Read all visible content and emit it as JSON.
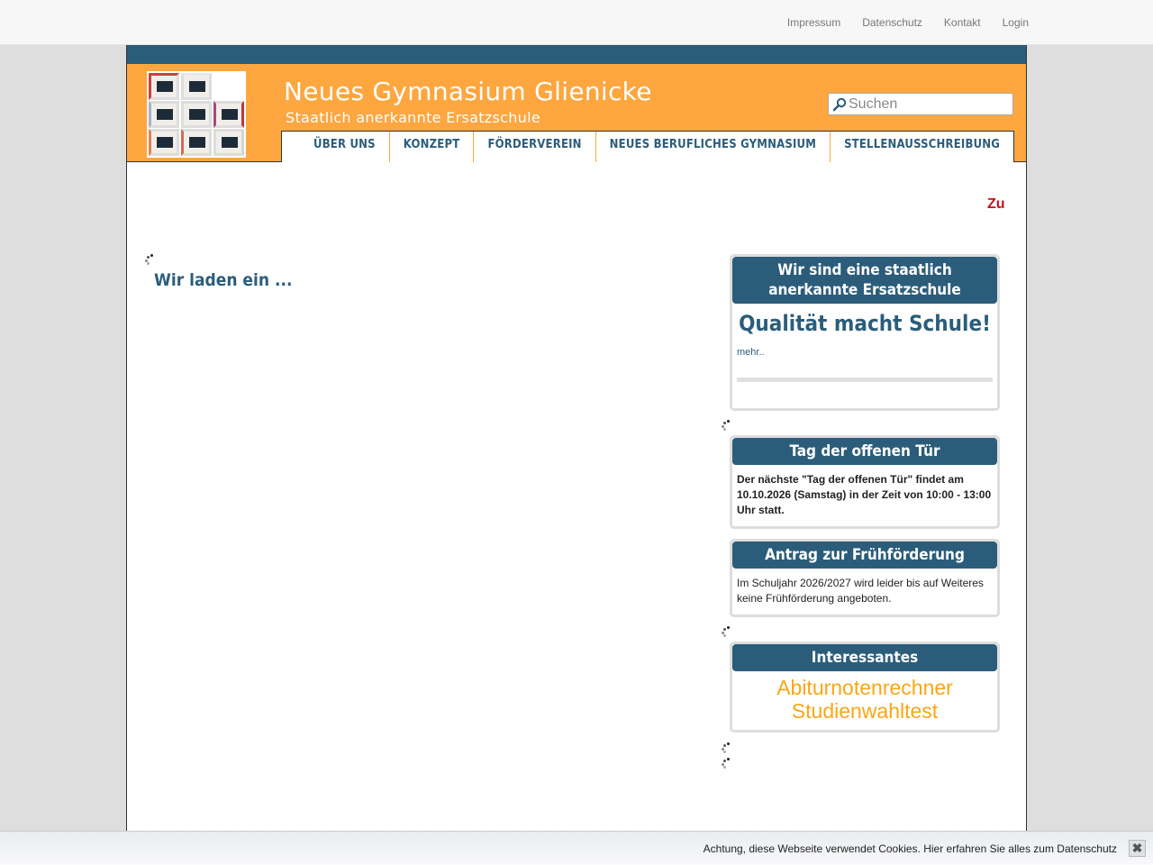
{
  "topnav": {
    "impressum": "Impressum",
    "datenschutz": "Datenschutz",
    "kontakt": "Kontakt",
    "login": "Login"
  },
  "header": {
    "title": "Neues Gymnasium Glienicke",
    "subtitle": "Staatlich anerkannte Ersatzschule",
    "brand_color": "#fea63f",
    "accent_color": "#2b5d7b"
  },
  "search": {
    "placeholder": "Suchen",
    "icon": "search-icon"
  },
  "mainnav": [
    {
      "label": "Über uns"
    },
    {
      "label": "Konzept"
    },
    {
      "label": "Förderverein"
    },
    {
      "label": "Neues berufliches Gymnasium"
    },
    {
      "label": "Stellenausschreibung"
    }
  ],
  "ticker": {
    "text": "Zu"
  },
  "main": {
    "lead": "Wir laden ein ..."
  },
  "sidebar": {
    "quality": {
      "heading": "Wir sind eine staatlich anerkannte Ersatzschule",
      "slogan": "Qualität macht Schule!",
      "more": "mehr.."
    },
    "open_day": {
      "heading": "Tag der offenen Tür",
      "text": "Der nächste \"Tag der offenen Tür\" findet am 10.10.2026 (Samstag) in der Zeit von 10:00 - 13:00 Uhr statt."
    },
    "early": {
      "heading": "Antrag zur Frühförderung",
      "text": "Im Schuljahr 2026/2027 wird leider bis auf Weiteres keine Frühförderung angeboten."
    },
    "interesting": {
      "heading": "Interessantes",
      "links": [
        "Abiturnotenrechner",
        "Studienwahltest"
      ],
      "link_color": "#f9a615"
    }
  },
  "cookie": {
    "message": "Achtung, diese Webseite verwendet Cookies. Hier erfahren Sie alles zum Datenschutz",
    "close": "✖"
  }
}
